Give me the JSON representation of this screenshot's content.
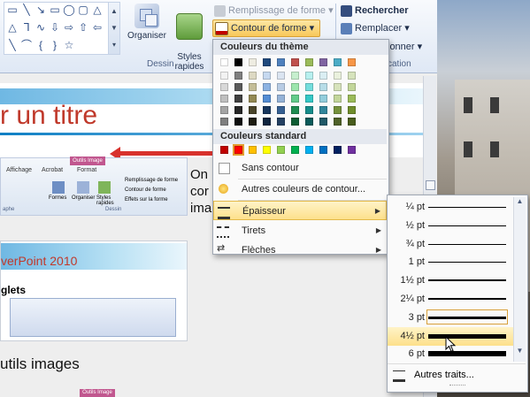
{
  "ribbon": {
    "organiser_label": "Organiser",
    "styles_label": "Styles\nrapides",
    "remplissage_label": "Remplissage de forme",
    "contour_label": "Contour de forme",
    "rechercher_label": "Rechercher",
    "remplacer_label": "Remplacer",
    "selectionner_partial": "ionner",
    "dessin_group": "Dessin",
    "edition_partial": "cation",
    "gallery_scroll": [
      "▲",
      "▼",
      "▾"
    ]
  },
  "slide": {
    "title_partial": "r un titre",
    "on_text": "On",
    "cor_text": "cor",
    "ima_text": "ima",
    "powerpoint_text": "verPoint 2010",
    "glets_text": "glets",
    "outils_text": "utils images",
    "outils_tab": "Outils Image"
  },
  "thumb": {
    "context_tab": "Outils Image",
    "tabs": [
      "Affichage",
      "Acrobat",
      "Format"
    ],
    "buttons": [
      "Formes",
      "Organiser",
      "Styles rapides"
    ],
    "commands": [
      "Remplissage de forme",
      "Contour de forme",
      "Effets sur la forme"
    ],
    "group_left": "aphe",
    "group_dessin": "Dessin"
  },
  "menu": {
    "theme_header": "Couleurs du thème",
    "standard_header": "Couleurs standard",
    "no_outline": "Sans contour",
    "more_colors": "Autres couleurs de contour...",
    "weight": "Épaisseur",
    "dashes": "Tirets",
    "arrows": "Flèches",
    "theme_top_row": [
      "#ffffff",
      "#000000",
      "#eeece1",
      "#1f497d",
      "#4f81bd",
      "#c0504d",
      "#9bbb59",
      "#8064a2",
      "#4bacc6",
      "#f79646"
    ],
    "theme_columns": [
      [
        "#f2f2f2",
        "#d8d8d8",
        "#bfbfbf",
        "#a5a5a5",
        "#7f7f7f"
      ],
      [
        "#7f7f7f",
        "#595959",
        "#3f3f3f",
        "#262626",
        "#0c0c0c"
      ],
      [
        "#ddd9c3",
        "#c4bd97",
        "#938953",
        "#494429",
        "#1d1b10"
      ],
      [
        "#c6d9f0",
        "#8db3e2",
        "#548dd4",
        "#17365d",
        "#0f243e"
      ],
      [
        "#dbe5f1",
        "#b8cce4",
        "#95b3d7",
        "#366092",
        "#244061"
      ],
      [
        "#c6efce",
        "#9ce6ad",
        "#62cc8a",
        "#1e8c50",
        "#0d5c33"
      ],
      [
        "#b7f0ef",
        "#74dedd",
        "#34c8c6",
        "#168d8b",
        "#0b5a59"
      ],
      [
        "#daeef3",
        "#b7dde8",
        "#92cddc",
        "#31859b",
        "#205867"
      ],
      [
        "#eaf1dd",
        "#d7e3bc",
        "#c3d69b",
        "#76923c",
        "#4f6128"
      ],
      [
        "#d6e3bc",
        "#c2d69a",
        "#9bbb59",
        "#6f8d2b",
        "#485c1c"
      ]
    ],
    "standard_colors": [
      "#c00000",
      "#ff0000",
      "#ffc000",
      "#ffff00",
      "#92d050",
      "#00b050",
      "#00b0f0",
      "#0070c0",
      "#002060",
      "#7030a0"
    ]
  },
  "weights": {
    "items": [
      {
        "label": "¼ pt",
        "stroke": 1
      },
      {
        "label": "½ pt",
        "stroke": 1
      },
      {
        "label": "¾ pt",
        "stroke": 1
      },
      {
        "label": "1 pt",
        "stroke": 1
      },
      {
        "label": "1½ pt",
        "stroke": 2
      },
      {
        "label": "2¼ pt",
        "stroke": 2
      },
      {
        "label": "3 pt",
        "stroke": 3
      },
      {
        "label": "4½ pt",
        "stroke": 5
      },
      {
        "label": "6 pt",
        "stroke": 6
      }
    ],
    "hovered_index": 7,
    "boxed_index": 6,
    "more_lines": "Autres traits..."
  }
}
